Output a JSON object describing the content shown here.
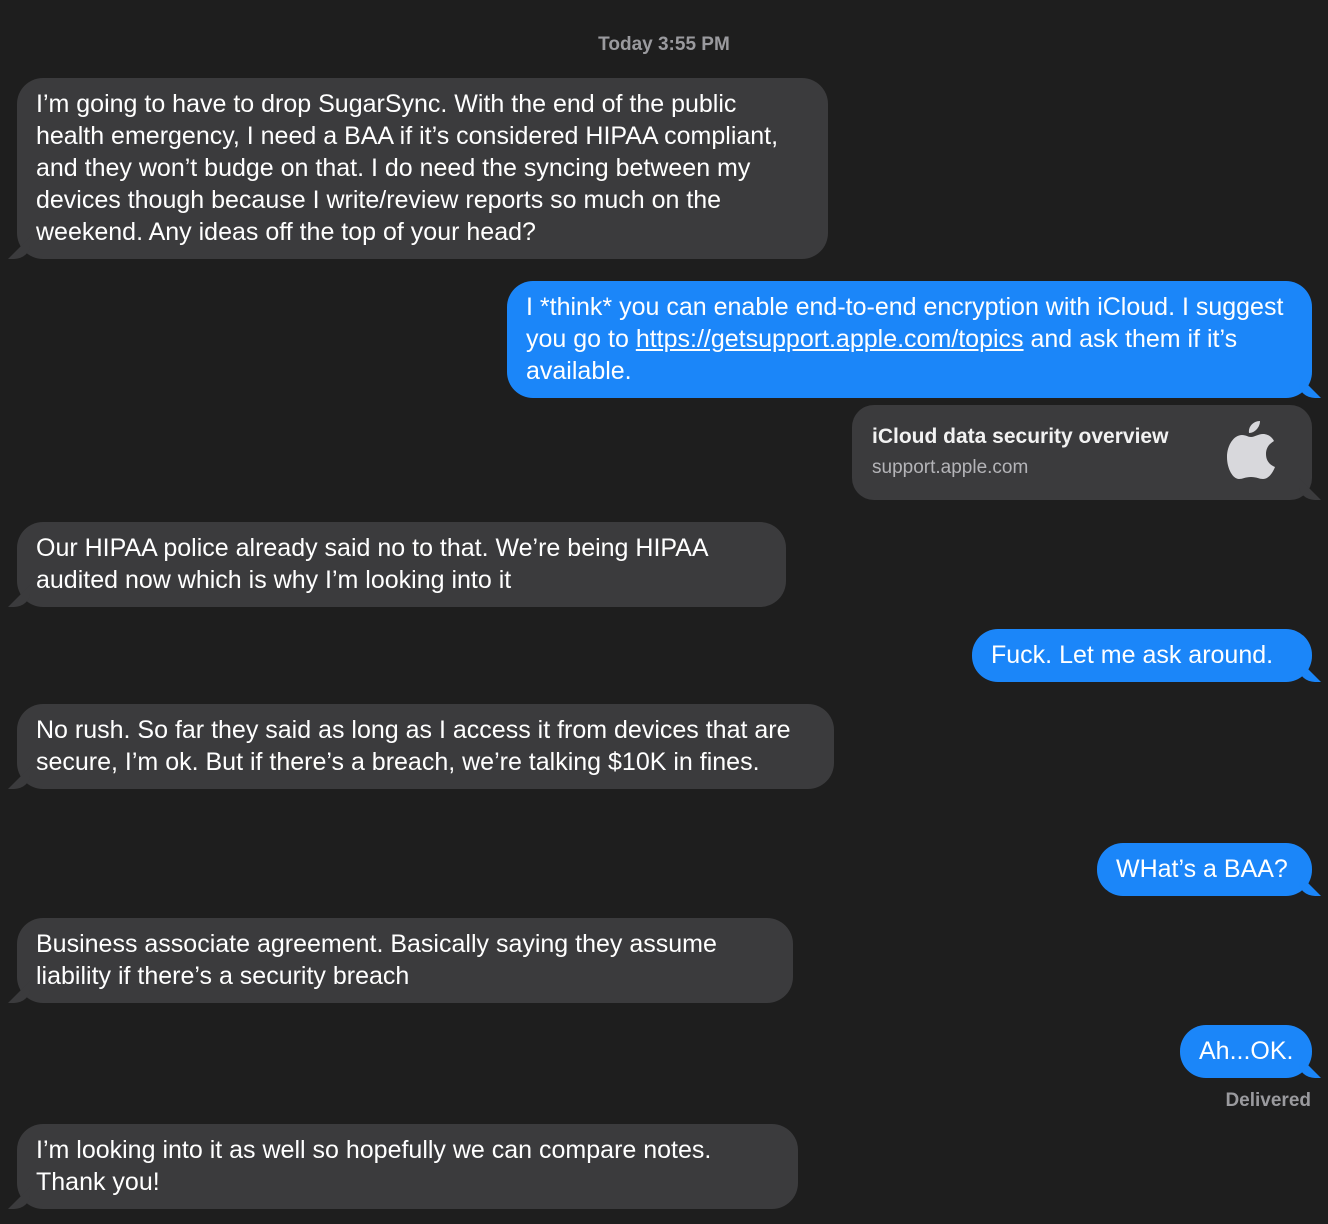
{
  "timestamp": "Today 3:55 PM",
  "messages": [
    {
      "from": "them",
      "text": "I’m going to have to drop SugarSync. With the end of the public health emergency, I need a BAA if it’s considered HIPAA compliant, and they won’t budge on that. I do need the syncing between my devices though because I write/review reports so much on the weekend. Any ideas off the top of your head?"
    },
    {
      "from": "me",
      "text_before": "I *think* you can enable end-to-end encryption with iCloud. I suggest you go to ",
      "link": "https://getsupport.apple.com/topics",
      "text_after": " and ask them if it’s available."
    },
    {
      "from": "them",
      "text": "Our HIPAA police already said no to that. We’re being HIPAA audited now which is why I’m looking into it"
    },
    {
      "from": "me",
      "text": "Fuck. Let me ask around."
    },
    {
      "from": "them",
      "text": "No rush. So far they said as long as I access it from devices that are secure, I’m ok. But if there’s a breach, we’re talking $10K in fines."
    },
    {
      "from": "me",
      "text": "WHat’s a BAA?"
    },
    {
      "from": "them",
      "text": "Business associate agreement. Basically saying they assume liability if there’s a security breach"
    },
    {
      "from": "me",
      "text": "Ah...OK."
    },
    {
      "from": "them",
      "text": "I’m looking into it as well so hopefully we can compare notes. Thank you!"
    }
  ],
  "link_preview": {
    "title": "iCloud data security overview",
    "domain": "support.apple.com",
    "icon": "apple-logo-icon"
  },
  "status": "Delivered",
  "colors": {
    "background": "#1e1e1e",
    "incoming_bubble": "#3b3b3d",
    "outgoing_bubble": "#1b86f9",
    "meta_text": "#9a9a9e"
  }
}
